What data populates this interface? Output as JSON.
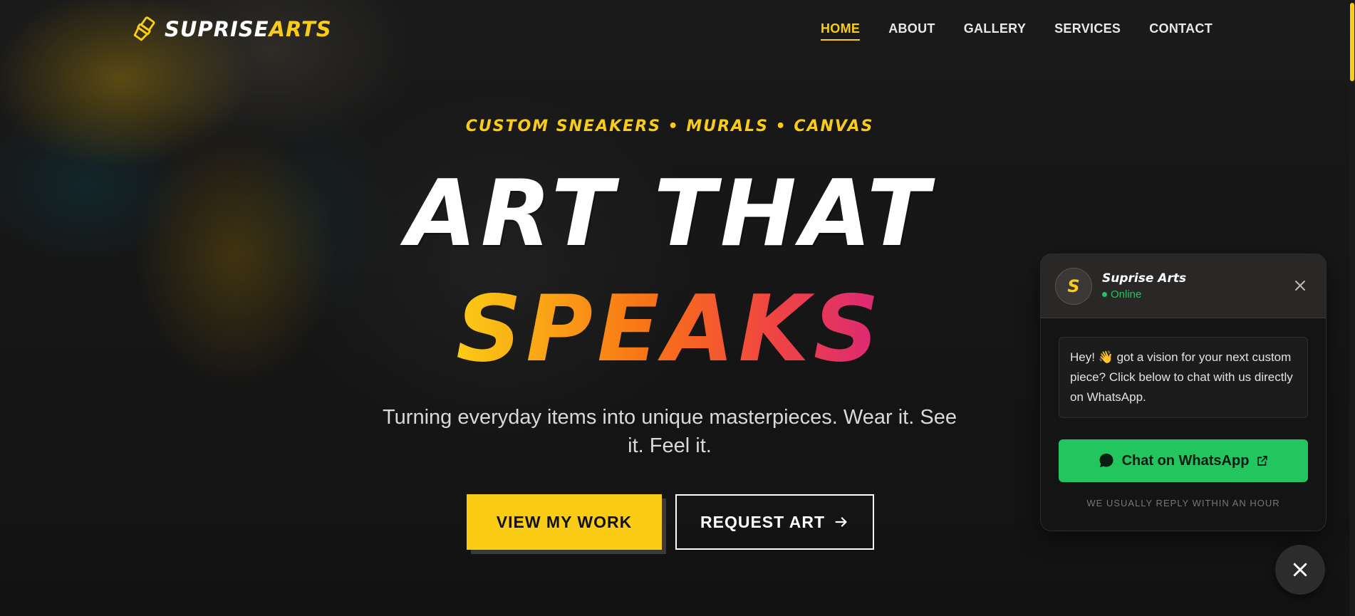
{
  "brand": {
    "part1": "SUPRISE",
    "part2": "ARTS"
  },
  "nav": {
    "items": [
      {
        "label": "HOME"
      },
      {
        "label": "ABOUT"
      },
      {
        "label": "GALLERY"
      },
      {
        "label": "SERVICES"
      },
      {
        "label": "CONTACT"
      }
    ],
    "active": "HOME"
  },
  "hero": {
    "tagline": "CUSTOM SNEAKERS • MURALS • CANVAS",
    "headline_line1": "ART THAT",
    "headline_line2": "SPEAKS",
    "subtitle": "Turning everyday items into unique masterpieces. Wear it. See it. Feel it.",
    "primary_button": "VIEW MY WORK",
    "secondary_button": "REQUEST ART"
  },
  "chat": {
    "avatar_letter": "S",
    "name": "Suprise Arts",
    "status": "Online",
    "message": "Hey! 👋 got a vision for your next custom piece? Click below to chat with us directly on WhatsApp.",
    "button": "Chat on WhatsApp",
    "note": "WE USUALLY REPLY WITHIN AN HOUR"
  },
  "colors": {
    "accent": "#facc15",
    "whatsapp": "#22c55e",
    "gradient": [
      "#facc15",
      "#f97316",
      "#ef4444",
      "#db2777"
    ]
  },
  "icons": [
    "paintbrush-icon",
    "close-icon",
    "arrow-right-icon",
    "chat-bubble-icon",
    "external-link-icon"
  ]
}
